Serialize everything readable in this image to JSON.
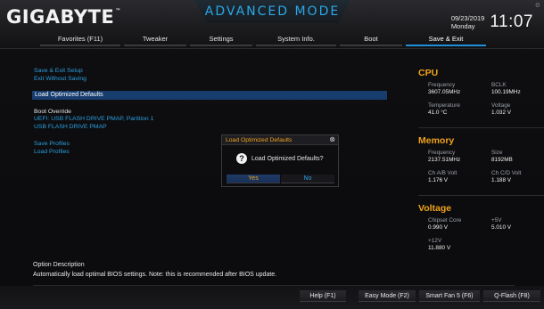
{
  "header": {
    "logo": "GIGABYTE",
    "logo_mark": "™",
    "mode_title": "ADVANCED MODE",
    "date": "09/23/2019",
    "day": "Monday",
    "time": "11:07",
    "settings_glyph": "⚙"
  },
  "tabs": [
    {
      "label": "Favorites (F11)",
      "active": false
    },
    {
      "label": "Tweaker",
      "active": false
    },
    {
      "label": "Settings",
      "active": false
    },
    {
      "label": "System Info.",
      "active": false
    },
    {
      "label": "Boot",
      "active": false
    },
    {
      "label": "Save & Exit",
      "active": true
    }
  ],
  "menu": {
    "save_exit_setup": "Save & Exit Setup",
    "exit_without_saving": "Exit Without Saving",
    "load_optimized_defaults": "Load Optimized Defaults",
    "boot_override_label": "Boot Override",
    "boot_override_items": [
      "UEFI: USB FLASH DRIVE PMAP, Partition 1",
      "USB FLASH DRIVE PMAP"
    ],
    "save_profiles": "Save Profiles",
    "load_profiles": "Load Profiles"
  },
  "dialog": {
    "title": "Load Optimized Defaults",
    "close_glyph": "⊗",
    "question_glyph": "?",
    "message": "Load Optimized Defaults?",
    "yes_label": "Yes",
    "no_label": "No"
  },
  "panel": {
    "cpu": {
      "title": "CPU",
      "frequency_label": "Frequency",
      "frequency_value": "3607.05MHz",
      "bclk_label": "BCLK",
      "bclk_value": "100.19MHz",
      "temperature_label": "Temperature",
      "temperature_value": "41.0 °C",
      "voltage_label": "Voltage",
      "voltage_value": "1.032 V"
    },
    "memory": {
      "title": "Memory",
      "frequency_label": "Frequency",
      "frequency_value": "2137.51MHz",
      "size_label": "Size",
      "size_value": "8192MB",
      "chab_label": "Ch A/B Volt",
      "chab_value": "1.176 V",
      "chcd_label": "Ch C/D Volt",
      "chcd_value": "1.188 V"
    },
    "voltage": {
      "title": "Voltage",
      "chipset_label": "Chipset Core",
      "chipset_value": "0.990 V",
      "p5v_label": "+5V",
      "p5v_value": "5.010 V",
      "p12v_label": "+12V",
      "p12v_value": "11.880 V"
    }
  },
  "description": {
    "title": "Option Description",
    "text": "Automatically load optimal BIOS settings. Note: this is recommended after BIOS update."
  },
  "bottom_buttons": [
    {
      "label": "Help (F1)"
    },
    {
      "label": "Easy Mode (F2)"
    },
    {
      "label": "Smart Fan 5 (F6)"
    },
    {
      "label": "Q-Flash (F8)"
    }
  ],
  "colors": {
    "accent_blue": "#2aa0e0",
    "accent_orange": "#f0a21c",
    "highlight_row": "#173d6f",
    "background": "#0b0b0d"
  }
}
